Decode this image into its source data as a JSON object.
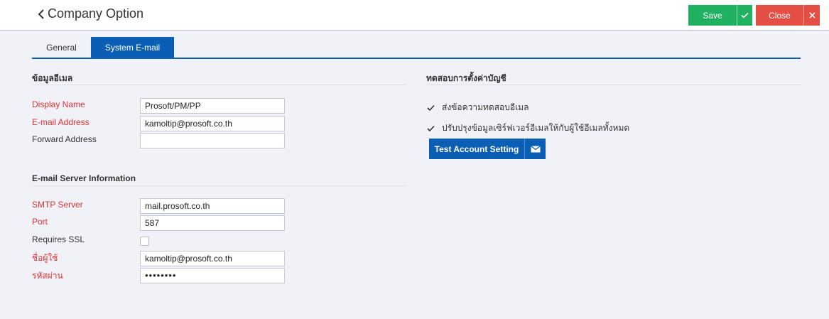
{
  "header": {
    "title": "Company Option",
    "save_label": "Save",
    "close_label": "Close"
  },
  "tabs": [
    {
      "label": "General",
      "active": false
    },
    {
      "label": "System E-mail",
      "active": true
    }
  ],
  "email_info": {
    "section_title": "ข้อมูลอีเมล",
    "display_name_label": "Display Name",
    "display_name_value": "Prosoft/PM/PP",
    "email_address_label": "E-mail Address",
    "email_address_value": "kamoltip@prosoft.co.th",
    "forward_address_label": "Forward Address",
    "forward_address_value": ""
  },
  "server_info": {
    "section_title": "E-mail Server Information",
    "smtp_label": "SMTP Server",
    "smtp_value": "mail.prosoft.co.th",
    "port_label": "Port",
    "port_value": "587",
    "ssl_label": "Requires SSL",
    "ssl_checked": false,
    "username_label": "ชื่อผู้ใช้",
    "username_value": "kamoltip@prosoft.co.th",
    "password_label": "รหัสผ่าน",
    "password_value": "••••••••"
  },
  "test_settings": {
    "section_title": "ทดสอบการตั้งค่าบัญชี",
    "send_test_label": "ส่งข้อความทดสอบอีเมล",
    "send_test_checked": true,
    "update_all_label": "ปรับปรุงข้อมูลเซิร์ฟเวอร์อีเมลให้กับผู้ใช้อีเมลทั้งหมด",
    "update_all_checked": true,
    "test_button_label": "Test Account Setting"
  },
  "colors": {
    "primary": "#0a5fb4",
    "save": "#21b163",
    "close": "#e54e44",
    "required": "#e03131"
  },
  "icons": {
    "back": "chevron-left-icon",
    "save": "check-icon",
    "close": "close-icon",
    "test": "envelope-icon",
    "checkbox": "checkmark-icon"
  }
}
